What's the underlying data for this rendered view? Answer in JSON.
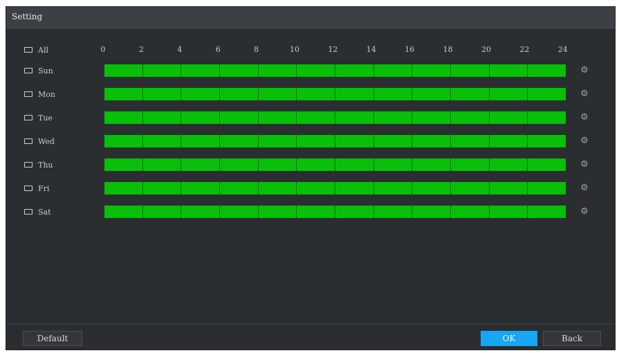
{
  "window": {
    "title": "Setting"
  },
  "all_label": "All",
  "hours": [
    "0",
    "2",
    "4",
    "6",
    "8",
    "10",
    "12",
    "14",
    "16",
    "18",
    "20",
    "22",
    "24"
  ],
  "days": [
    {
      "label": "Sun",
      "fill": 1.0
    },
    {
      "label": "Mon",
      "fill": 1.0
    },
    {
      "label": "Tue",
      "fill": 1.0
    },
    {
      "label": "Wed",
      "fill": 1.0
    },
    {
      "label": "Thu",
      "fill": 1.0
    },
    {
      "label": "Fri",
      "fill": 1.0
    },
    {
      "label": "Sat",
      "fill": 1.0
    }
  ],
  "buttons": {
    "default": "Default",
    "ok": "OK",
    "back": "Back"
  },
  "colors": {
    "schedule_fill": "#07c007",
    "ok_button": "#17a6f2",
    "background": "#2b2e31"
  },
  "icons": {
    "row_setting": "gear-icon"
  }
}
